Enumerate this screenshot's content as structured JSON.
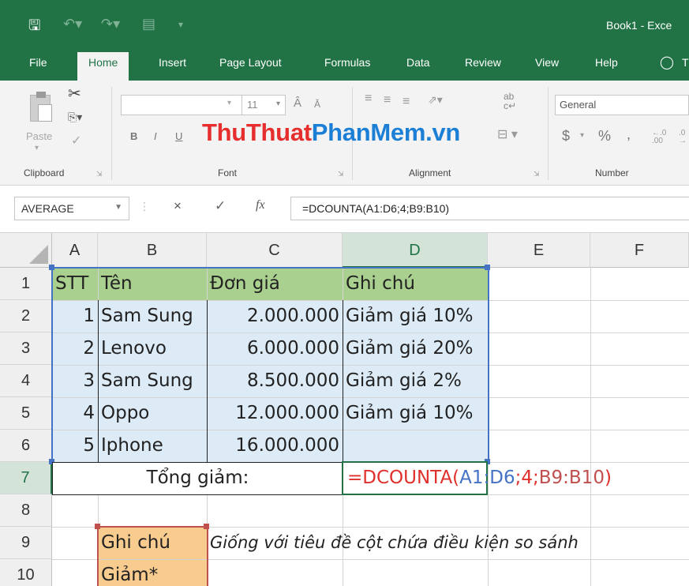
{
  "window": {
    "title": "Book1  -  Exce"
  },
  "quick_access": {
    "save_icon": "save-icon",
    "undo_icon": "undo-icon",
    "redo_icon": "redo-icon",
    "form_icon": "form-icon",
    "customize_icon": "customize-icon"
  },
  "tabs": [
    {
      "label": "File",
      "active": false
    },
    {
      "label": "Home",
      "active": true
    },
    {
      "label": "Insert",
      "active": false
    },
    {
      "label": "Page Layout",
      "active": false
    },
    {
      "label": "Formulas",
      "active": false
    },
    {
      "label": "Data",
      "active": false
    },
    {
      "label": "Review",
      "active": false
    },
    {
      "label": "View",
      "active": false
    },
    {
      "label": "Help",
      "active": false
    }
  ],
  "ribbon": {
    "clipboard": {
      "label": "Clipboard",
      "paste": "Paste"
    },
    "font": {
      "label": "Font",
      "size": "11",
      "bold": "B",
      "italic": "I",
      "underline": "U"
    },
    "alignment": {
      "label": "Alignment"
    },
    "number": {
      "label": "Number",
      "format": "General",
      "currency": "$",
      "percent": "%",
      "comma": ","
    },
    "watermark_a": "ThuThuat",
    "watermark_b": "PhanMem.vn"
  },
  "formula_bar": {
    "name_box": "AVERAGE",
    "cancel": "×",
    "enter": "✓",
    "fx": "fx",
    "formula": "=DCOUNTA(A1:D6;4;B9:B10)"
  },
  "columns": [
    "A",
    "B",
    "C",
    "D",
    "E",
    "F"
  ],
  "rows": [
    "1",
    "2",
    "3",
    "4",
    "5",
    "6",
    "7",
    "8",
    "9",
    "10"
  ],
  "table": {
    "headers": [
      "STT",
      "Tên",
      "Đơn giá",
      "Ghi chú"
    ],
    "rows": [
      [
        "1",
        "Sam Sung",
        "2.000.000",
        "Giảm giá 10%"
      ],
      [
        "2",
        "Lenovo",
        "6.000.000",
        "Giảm giá 20%"
      ],
      [
        "3",
        "Sam Sung",
        "8.500.000",
        "Giảm giá 2%"
      ],
      [
        "4",
        "Oppo",
        "12.000.000",
        "Giảm giá 10%"
      ],
      [
        "5",
        "Iphone",
        "16.000.000",
        ""
      ]
    ]
  },
  "total": {
    "label": "Tổng giảm:",
    "formula_parts": [
      "=DCOUNTA(",
      "A1:D6",
      ";",
      "4",
      ";",
      "B9:B10",
      ")"
    ]
  },
  "criteria": {
    "header": "Ghi chú",
    "value": "Giảm*",
    "note": "Giống với tiêu đề cột chứa điều kiện so sánh"
  },
  "colors": {
    "excel_green": "#217346",
    "header_fill": "#a9d08e",
    "body_fill": "#ddebf7",
    "criteria_fill": "#f8cb8e",
    "ref_blue": "#4472c4",
    "ref_red": "#c0504d",
    "formula_red": "#e0302b"
  }
}
